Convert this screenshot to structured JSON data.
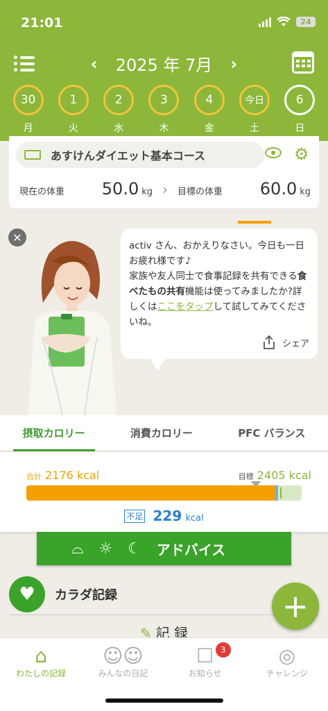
{
  "status": {
    "time": "21:01",
    "battery": "24"
  },
  "header": {
    "month_title": "2025 年 7月",
    "prev": "‹",
    "next": "›"
  },
  "days": [
    {
      "num": "30",
      "dow": "月"
    },
    {
      "num": "1",
      "dow": "火"
    },
    {
      "num": "2",
      "dow": "水"
    },
    {
      "num": "3",
      "dow": "木"
    },
    {
      "num": "4",
      "dow": "金"
    },
    {
      "num": "今日",
      "dow": "土"
    },
    {
      "num": "6",
      "dow": "日"
    }
  ],
  "course": {
    "name": "あすけんダイエット基本コース",
    "current_label": "現在の体重",
    "current_value": "50.0",
    "goal_label": "目標の体重",
    "goal_value": "60.0",
    "unit": "kg"
  },
  "assistant": {
    "line1": "activ さん、おかえりなさい。今日も一日お疲れ様です♪",
    "line2a": "家族や友人同士で食事記録を共有できる",
    "line2b": "食べたもの共有",
    "line2c": "機能は使ってみましたか?詳しくは",
    "link": "ここをタップ",
    "line2d": "して試してみてくださいね。",
    "share_label": "シェア"
  },
  "tabs": [
    "摂取カロリー",
    "消費カロリー",
    "PFC バランス"
  ],
  "calories": {
    "total_label": "合計",
    "total_value": "2176",
    "goal_label": "目標",
    "goal_value": "2405",
    "unit": "kcal",
    "shortfall_tag": "不足",
    "shortfall_value": "229",
    "progress_fraction": 0.905
  },
  "advice": {
    "label": "アドバイス",
    "icons": [
      "sunrise-icon",
      "sun-icon",
      "moon-icon"
    ]
  },
  "body_record": {
    "label": "カラダ記録"
  },
  "record": {
    "label": "記 録"
  },
  "nav": [
    {
      "label": "わたしの記録",
      "icon": "home-icon"
    },
    {
      "label": "みんなの日記",
      "icon": "people-icon"
    },
    {
      "label": "お知らせ",
      "icon": "chat-icon",
      "badge": "3"
    },
    {
      "label": "チャレンジ",
      "icon": "medal-icon"
    }
  ],
  "colors": {
    "brand": "#8cb73a",
    "accent": "#3aa329",
    "calorie": "#f5a000",
    "shortfall": "#2a7fd4"
  }
}
